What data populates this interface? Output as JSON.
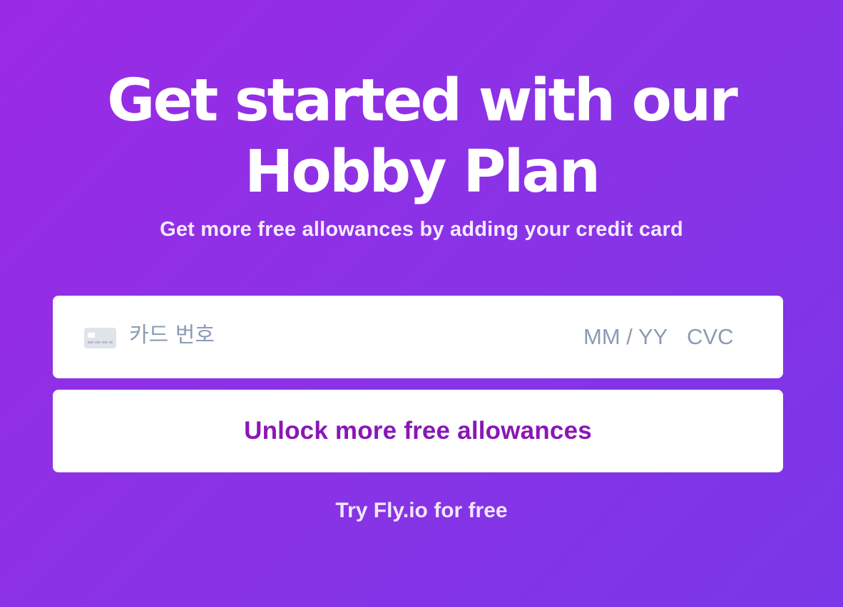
{
  "hero": {
    "title_line1": "Get started with our",
    "title_line2": "Hobby Plan",
    "subtitle": "Get more free allowances by adding your credit card"
  },
  "card_form": {
    "card_icon": "credit-card-icon",
    "card_number_placeholder": "카드 번호",
    "expiry_placeholder": "MM / YY",
    "cvc_placeholder": "CVC"
  },
  "actions": {
    "unlock_label": "Unlock more free allowances",
    "try_free_label": "Try Fly.io for free"
  },
  "colors": {
    "background_start": "#9b2ae6",
    "background_end": "#7a36e8",
    "button_text": "#8a17b5",
    "placeholder": "#8c9bb3"
  }
}
